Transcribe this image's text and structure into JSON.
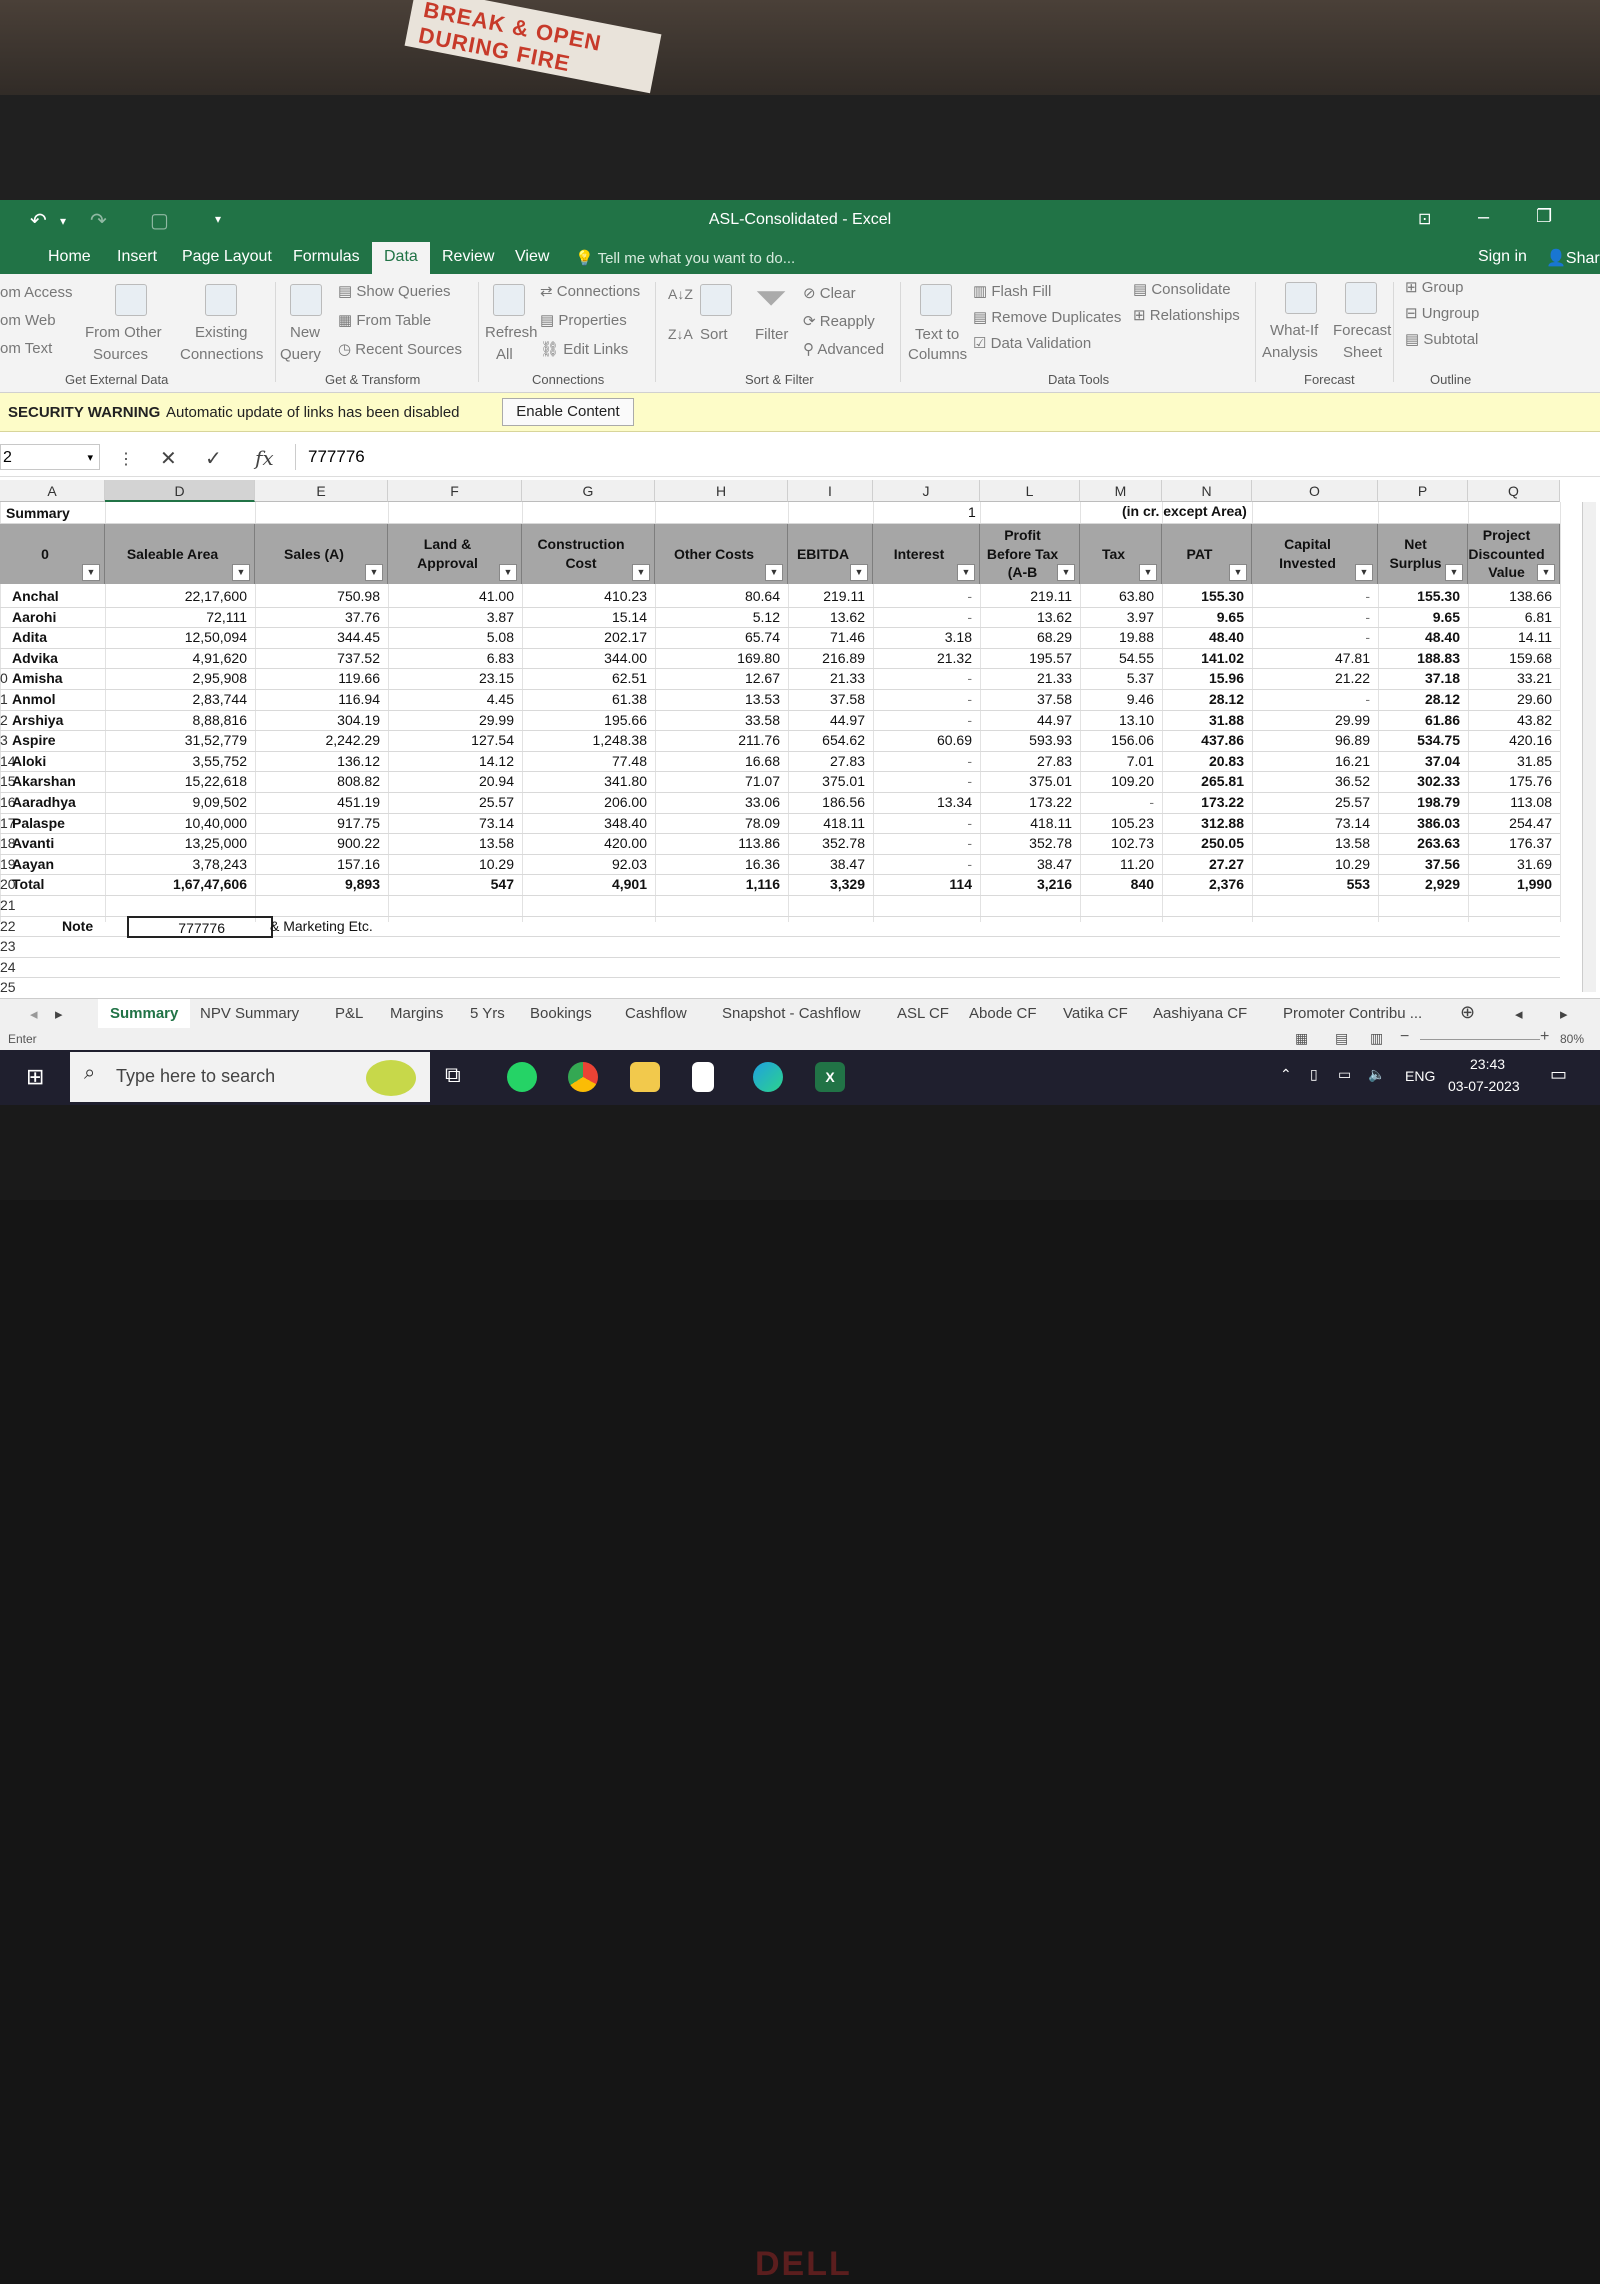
{
  "photo": {
    "sign_text": "BREAK & OPEN DURING FIRE",
    "brand": "DELL"
  },
  "window": {
    "title": "ASL-Consolidated - Excel",
    "sign_in": "Sign in",
    "share": "Shar"
  },
  "tabs": [
    "Home",
    "Insert",
    "Page Layout",
    "Formulas",
    "Data",
    "Review",
    "View"
  ],
  "active_tab": "Data",
  "tell_me": "Tell me what you want to do...",
  "ribbon": {
    "get_external": {
      "items": [
        "om Access",
        "om Web",
        "om Text"
      ],
      "from_other": "From Other",
      "sources": "Sources",
      "existing": "Existing",
      "connections": "Connections",
      "label": "Get External Data"
    },
    "get_transform": {
      "new": "New",
      "query": "Query",
      "show_queries": "Show Queries",
      "from_table": "From Table",
      "recent_sources": "Recent Sources",
      "label": "Get & Transform"
    },
    "connections": {
      "refresh": "Refresh",
      "all": "All",
      "connections": "Connections",
      "properties": "Properties",
      "edit_links": "Edit Links",
      "label": "Connections"
    },
    "sort_filter": {
      "sort": "Sort",
      "filter": "Filter",
      "clear": "Clear",
      "reapply": "Reapply",
      "advanced": "Advanced",
      "label": "Sort & Filter"
    },
    "data_tools": {
      "text_to": "Text to",
      "columns": "Columns",
      "flash_fill": "Flash Fill",
      "remove_duplicates": "Remove Duplicates",
      "data_validation": "Data Validation",
      "consolidate": "Consolidate",
      "relationships": "Relationships",
      "label": "Data Tools"
    },
    "forecast": {
      "what_if": "What-If",
      "analysis": "Analysis",
      "forecast": "Forecast",
      "sheet": "Sheet",
      "label": "Forecast"
    },
    "outline": {
      "group": "Group",
      "ungroup": "Ungroup",
      "subtotal": "Subtotal",
      "label": "Outline"
    }
  },
  "security": {
    "title": "SECURITY WARNING",
    "message": "Automatic update of links has been disabled",
    "button": "Enable Content"
  },
  "formula_bar": {
    "name_box": "2",
    "value": "777776"
  },
  "columns": [
    "A",
    "D",
    "E",
    "F",
    "G",
    "H",
    "I",
    "J",
    "L",
    "M",
    "N",
    "O",
    "P",
    "Q"
  ],
  "sheet": {
    "summary_label": "Summary",
    "marker": "1",
    "units_note": "(in cr. except Area)",
    "headers": [
      "0",
      "Saleable Area",
      "Sales (A)",
      "Land & Approval",
      "Construction Cost",
      "Other Costs",
      "EBITDA",
      "Interest",
      "Profit Before Tax (A-B",
      "Tax",
      "PAT",
      "Capital Invested",
      "Net Surplus",
      "Project Discounted Value"
    ],
    "rows": [
      {
        "rn": "",
        "name": "Anchal",
        "v": [
          "22,17,600",
          "750.98",
          "41.00",
          "410.23",
          "80.64",
          "219.11",
          "-",
          "219.11",
          "63.80",
          "155.30",
          "-",
          "155.30",
          "138.66"
        ]
      },
      {
        "rn": "",
        "name": "Aarohi",
        "v": [
          "72,111",
          "37.76",
          "3.87",
          "15.14",
          "5.12",
          "13.62",
          "-",
          "13.62",
          "3.97",
          "9.65",
          "-",
          "9.65",
          "6.81"
        ]
      },
      {
        "rn": "",
        "name": "Adita",
        "v": [
          "12,50,094",
          "344.45",
          "5.08",
          "202.17",
          "65.74",
          "71.46",
          "3.18",
          "68.29",
          "19.88",
          "48.40",
          "-",
          "48.40",
          "14.11"
        ]
      },
      {
        "rn": "",
        "name": "Advika",
        "v": [
          "4,91,620",
          "737.52",
          "6.83",
          "344.00",
          "169.80",
          "216.89",
          "21.32",
          "195.57",
          "54.55",
          "141.02",
          "47.81",
          "188.83",
          "159.68"
        ]
      },
      {
        "rn": "0",
        "name": "Amisha",
        "v": [
          "2,95,908",
          "119.66",
          "23.15",
          "62.51",
          "12.67",
          "21.33",
          "-",
          "21.33",
          "5.37",
          "15.96",
          "21.22",
          "37.18",
          "33.21"
        ]
      },
      {
        "rn": "1",
        "name": "Anmol",
        "v": [
          "2,83,744",
          "116.94",
          "4.45",
          "61.38",
          "13.53",
          "37.58",
          "-",
          "37.58",
          "9.46",
          "28.12",
          "-",
          "28.12",
          "29.60"
        ]
      },
      {
        "rn": "2",
        "name": "Arshiya",
        "v": [
          "8,88,816",
          "304.19",
          "29.99",
          "195.66",
          "33.58",
          "44.97",
          "-",
          "44.97",
          "13.10",
          "31.88",
          "29.99",
          "61.86",
          "43.82"
        ]
      },
      {
        "rn": "3",
        "name": "Aspire",
        "v": [
          "31,52,779",
          "2,242.29",
          "127.54",
          "1,248.38",
          "211.76",
          "654.62",
          "60.69",
          "593.93",
          "156.06",
          "437.86",
          "96.89",
          "534.75",
          "420.16"
        ]
      },
      {
        "rn": "14",
        "name": "Aloki",
        "v": [
          "3,55,752",
          "136.12",
          "14.12",
          "77.48",
          "16.68",
          "27.83",
          "-",
          "27.83",
          "7.01",
          "20.83",
          "16.21",
          "37.04",
          "31.85"
        ]
      },
      {
        "rn": "15",
        "name": "Akarshan",
        "v": [
          "15,22,618",
          "808.82",
          "20.94",
          "341.80",
          "71.07",
          "375.01",
          "-",
          "375.01",
          "109.20",
          "265.81",
          "36.52",
          "302.33",
          "175.76"
        ]
      },
      {
        "rn": "16",
        "name": "Aaradhya",
        "v": [
          "9,09,502",
          "451.19",
          "25.57",
          "206.00",
          "33.06",
          "186.56",
          "13.34",
          "173.22",
          "-",
          "173.22",
          "25.57",
          "198.79",
          "113.08"
        ]
      },
      {
        "rn": "17",
        "name": "Palaspe",
        "v": [
          "10,40,000",
          "917.75",
          "73.14",
          "348.40",
          "78.09",
          "418.11",
          "-",
          "418.11",
          "105.23",
          "312.88",
          "73.14",
          "386.03",
          "254.47"
        ]
      },
      {
        "rn": "18",
        "name": "Avanti",
        "v": [
          "13,25,000",
          "900.22",
          "13.58",
          "420.00",
          "113.86",
          "352.78",
          "-",
          "352.78",
          "102.73",
          "250.05",
          "13.58",
          "263.63",
          "176.37"
        ]
      },
      {
        "rn": "19",
        "name": "Aayan",
        "v": [
          "3,78,243",
          "157.16",
          "10.29",
          "92.03",
          "16.36",
          "38.47",
          "-",
          "38.47",
          "11.20",
          "27.27",
          "10.29",
          "37.56",
          "31.69"
        ]
      },
      {
        "rn": "20",
        "name": "Total",
        "v": [
          "1,67,47,606",
          "9,893",
          "547",
          "4,901",
          "1,116",
          "3,329",
          "114",
          "3,216",
          "840",
          "2,376",
          "553",
          "2,929",
          "1,990"
        ]
      }
    ],
    "empty_rows": [
      "21",
      "22",
      "23",
      "24",
      "25"
    ],
    "note_label": "Note",
    "note_value": "777776",
    "note_text": "& Marketing Etc."
  },
  "sheet_tabs": [
    "Summary",
    "NPV Summary",
    "P&L",
    "Margins",
    "5 Yrs",
    "Bookings",
    "Cashflow",
    "Snapshot - Cashflow",
    "ASL CF",
    "Abode CF",
    "Vatika CF",
    "Aashiyana CF",
    "Promoter Contribu ..."
  ],
  "status": {
    "mode": "Enter",
    "zoom": "80%"
  },
  "taskbar": {
    "search_placeholder": "Type here to search",
    "lang": "ENG",
    "time": "23:43",
    "date": "03-07-2023"
  },
  "icons": [
    "undo-icon",
    "redo-icon",
    "search-icon",
    "lightbulb-icon",
    "filter-icon",
    "sort-icon",
    "windows-icon",
    "whatsapp-icon",
    "chrome-icon",
    "folder-icon",
    "edge-icon",
    "excel-icon"
  ],
  "colors": {
    "excel_green": "#217346",
    "header_gray": "#a6a6a6",
    "security_yellow": "#fdfcc8"
  }
}
